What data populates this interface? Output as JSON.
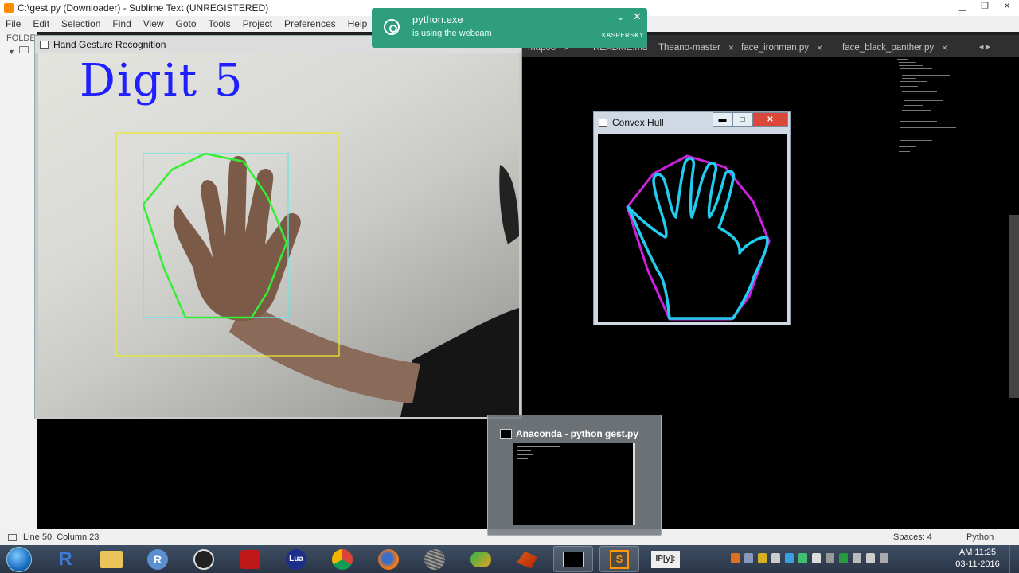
{
  "editor_window": {
    "title": "C:\\gest.py (Downloader) - Sublime Text (UNREGISTERED)",
    "min_icon": "minimize-icon",
    "max_icon": "maximize-icon",
    "close_icon": "close-icon"
  },
  "menu": [
    "File",
    "Edit",
    "Selection",
    "Find",
    "View",
    "Goto",
    "Tools",
    "Project",
    "Preferences",
    "Help"
  ],
  "sidebar": {
    "header": "FOLDER"
  },
  "tabs": [
    {
      "label": "mapoo",
      "close": "×"
    },
    {
      "label": "README.md",
      "close": "×"
    },
    {
      "label": "Theano-master",
      "close": "×"
    },
    {
      "label": "face_ironman.py",
      "close": "×"
    },
    {
      "label": "face_black_panther.py",
      "close": "×"
    }
  ],
  "tab_overflow": "◂ ▸",
  "hand_window": {
    "title": "Hand Gesture Recognition",
    "overlay_text": "Digit 5"
  },
  "hull_window": {
    "title": "Convex Hull",
    "min_label": "▬",
    "max_label": "□",
    "close_label": "✕"
  },
  "anaconda_preview": {
    "title": "Anaconda - python  gest.py"
  },
  "toast": {
    "app": "python.exe",
    "message": "is using the webcam",
    "brand": "KASPERSKY",
    "chevron": "⌄",
    "close": "✕"
  },
  "statusbar": {
    "position": "Line 50, Column 23",
    "spaces": "Spaces: 4",
    "syntax": "Python"
  },
  "taskbar": {
    "apps": [
      {
        "name": "R-icon",
        "label": "R"
      },
      {
        "name": "file-explorer-icon",
        "label": ""
      },
      {
        "name": "rstudio-icon",
        "label": "R"
      },
      {
        "name": "obs-icon",
        "label": ""
      },
      {
        "name": "acrobat-icon",
        "label": ""
      },
      {
        "name": "lua-icon",
        "label": "Lua"
      },
      {
        "name": "chrome-icon",
        "label": ""
      },
      {
        "name": "firefox-icon",
        "label": ""
      },
      {
        "name": "sphere-icon",
        "label": ""
      },
      {
        "name": "network-app-icon",
        "label": ""
      },
      {
        "name": "matlab-icon",
        "label": ""
      },
      {
        "name": "cmd-icon",
        "label": ""
      },
      {
        "name": "sublime-icon",
        "label": "S"
      },
      {
        "name": "ipython-icon",
        "label": "IP[y]:"
      }
    ],
    "clock_time": "AM 11:25",
    "clock_date": "03-11-2016"
  },
  "colors": {
    "toast_bg": "#2e9e7c",
    "digit_text": "#1f1fff",
    "hull_contour": "#22ccee",
    "hull_polygon": "#cc22dd",
    "bbox_outer": "#e8e830",
    "bbox_inner": "#66e8e8",
    "hull_green": "#33ee33"
  }
}
